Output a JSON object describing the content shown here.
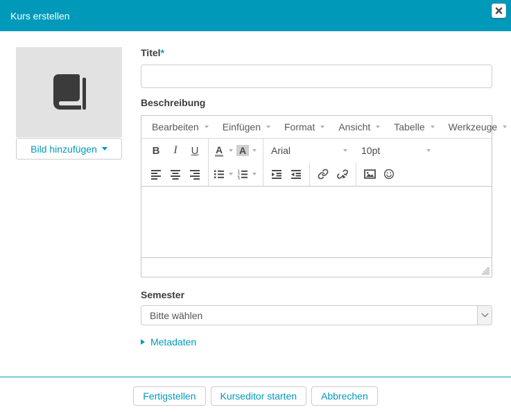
{
  "header": {
    "title": "Kurs erstellen"
  },
  "image_panel": {
    "add_image_label": "Bild hinzufügen"
  },
  "form": {
    "title": {
      "label": "Titel",
      "required_marker": "*",
      "value": ""
    },
    "description": {
      "label": "Beschreibung"
    },
    "semester": {
      "label": "Semester",
      "selected_option": "Bitte wählen"
    },
    "metadata_link": "Metadaten"
  },
  "editor": {
    "menubar": [
      "Bearbeiten",
      "Einfügen",
      "Format",
      "Ansicht",
      "Tabelle",
      "Werkzeuge"
    ],
    "toolbar": {
      "bold": "B",
      "italic": "I",
      "underline": "U",
      "forecolor": "A",
      "backcolor": "A",
      "font_family": "Arial",
      "font_size": "10pt"
    }
  },
  "footer": {
    "buttons": [
      "Fertigstellen",
      "Kurseditor starten",
      "Abbrechen"
    ]
  },
  "colors": {
    "accent": "#0099ba",
    "header_bg": "#0099ba",
    "icon": "#4a4a4a",
    "image_placeholder_bg": "#e2e2e2"
  },
  "icons": [
    "close-icon",
    "book-icon",
    "caret-down-icon",
    "align-left-icon",
    "align-center-icon",
    "align-right-icon",
    "bullet-list-icon",
    "numbered-list-icon",
    "indent-icon",
    "outdent-icon",
    "link-icon",
    "unlink-icon",
    "image-icon",
    "smiley-icon",
    "resize-grip-icon",
    "chevron-down-icon",
    "triangle-right-icon"
  ]
}
